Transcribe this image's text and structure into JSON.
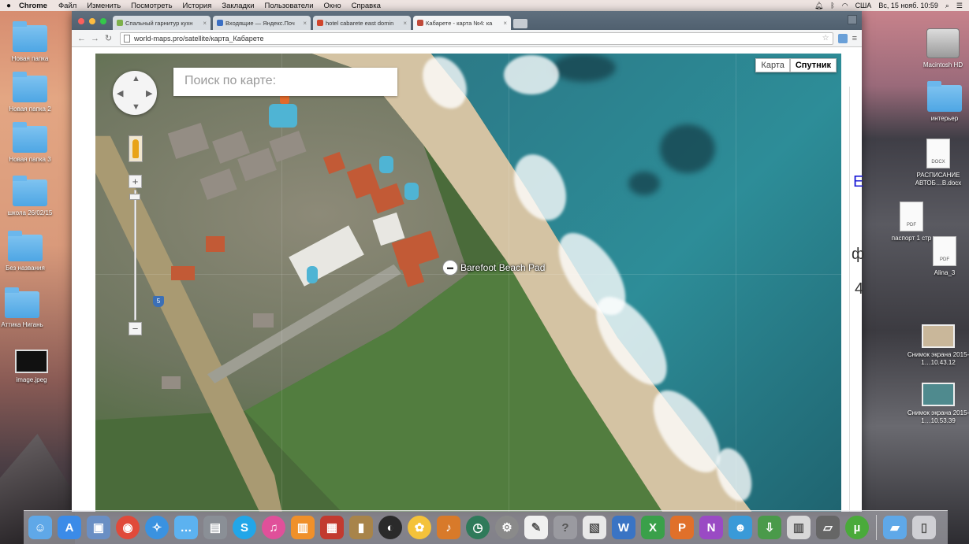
{
  "menubar": {
    "app_name": "Chrome",
    "items": [
      "Файл",
      "Изменить",
      "Посмотреть",
      "История",
      "Закладки",
      "Пользователи",
      "Окно",
      "Справка"
    ],
    "input_source": "США",
    "datetime": "Вс, 15 нояб.  10:59"
  },
  "desktop_left": [
    {
      "label": "Новая папка"
    },
    {
      "label": "Новая папка 2"
    },
    {
      "label": "Новая папка 3"
    },
    {
      "label": "школа 26/02/15"
    },
    {
      "label": "Без названия"
    },
    {
      "label": "Аттика Нигань"
    },
    {
      "label": "image.jpeg"
    }
  ],
  "desktop_right": [
    {
      "label": "Macintosh HD"
    },
    {
      "label": "интерьер"
    },
    {
      "label": "РАСПИСАНИЕ АВТОБ…В.docx",
      "badge": "DOCX"
    },
    {
      "label": "паспорт 1 стр",
      "badge": "PDF"
    },
    {
      "label": "Alina_3",
      "badge": "PDF"
    },
    {
      "label": "Снимок экрана 2015-1…10.43.12"
    },
    {
      "label": "Снимок экрана 2015-1…10.53.39"
    }
  ],
  "browser": {
    "tabs": [
      {
        "title": "Спальный гарнитур кухн",
        "active": false,
        "favicon_color": "#7db04a"
      },
      {
        "title": "Входящие — Яндекс.Поч",
        "active": false,
        "favicon_color": "#3a6fc4"
      },
      {
        "title": "hotel cabarete east domin",
        "active": false,
        "favicon_color": "#d0452c"
      },
      {
        "title": "Кабарете - карта №4: ка",
        "active": true,
        "favicon_color": "#c04a3a"
      }
    ],
    "url": "world-maps.pro/satellite/карта_Кабарете"
  },
  "map": {
    "search_placeholder": "Поиск по карте:",
    "type_map": "Карта",
    "type_satellite": "Спутник",
    "zoom_in": "+",
    "zoom_out": "−",
    "highway_shield": "5",
    "place_label": "Barefoot Beach Pad",
    "place_icon": "bed-icon"
  },
  "page_side": {
    "char1": "Е",
    "char2": "ф",
    "char3": "4"
  },
  "dock": [
    {
      "name": "finder-icon",
      "color": "#5fa8e8"
    },
    {
      "name": "app-store-icon",
      "color": "#3b8be8"
    },
    {
      "name": "preview-icon",
      "color": "#6a8fc4"
    },
    {
      "name": "chrome-icon",
      "color": "#e04a3a"
    },
    {
      "name": "safari-icon",
      "color": "#3a92e0"
    },
    {
      "name": "messages-icon",
      "color": "#5cb2f0"
    },
    {
      "name": "image-capture-icon",
      "color": "#8a8f96"
    },
    {
      "name": "skype-icon",
      "color": "#22a6e8"
    },
    {
      "name": "itunes-icon",
      "color": "#e0509a"
    },
    {
      "name": "ibooks-icon",
      "color": "#f0902a"
    },
    {
      "name": "photo-booth-icon",
      "color": "#c23a30"
    },
    {
      "name": "notes-icon",
      "color": "#a8844a"
    },
    {
      "name": "dashboard-icon",
      "color": "#2a2a2a"
    },
    {
      "name": "photos-icon",
      "color": "#f4c23a"
    },
    {
      "name": "garageband-icon",
      "color": "#d87a2a"
    },
    {
      "name": "time-machine-icon",
      "color": "#2f7a5a"
    },
    {
      "name": "system-preferences-icon",
      "color": "#8a8a8a"
    },
    {
      "name": "textedit-icon",
      "color": "#f0f0f0"
    },
    {
      "name": "help-icon",
      "color": "#9a9aa0"
    },
    {
      "name": "calendar-icon",
      "color": "#e8e8e8"
    },
    {
      "name": "word-icon",
      "color": "#3a74c4"
    },
    {
      "name": "excel-icon",
      "color": "#3aa04a"
    },
    {
      "name": "powerpoint-icon",
      "color": "#e0702a"
    },
    {
      "name": "onenote-icon",
      "color": "#9a4ac4"
    },
    {
      "name": "contacts-icon",
      "color": "#3a9ad8"
    },
    {
      "name": "downloads-globe-icon",
      "color": "#4a9a4a"
    },
    {
      "name": "library-icon",
      "color": "#d8d8d8"
    },
    {
      "name": "scanner-icon",
      "color": "#666"
    },
    {
      "name": "utorrent-icon",
      "color": "#4aaa3a"
    },
    {
      "name": "applications-folder-icon",
      "color": "#5fa8e8"
    },
    {
      "name": "trash-icon",
      "color": "#cfcfd4"
    }
  ],
  "colors": {
    "ocean": "#2c7f8c",
    "beach": "#d4c3a3",
    "vegetation": "#527d3f"
  }
}
